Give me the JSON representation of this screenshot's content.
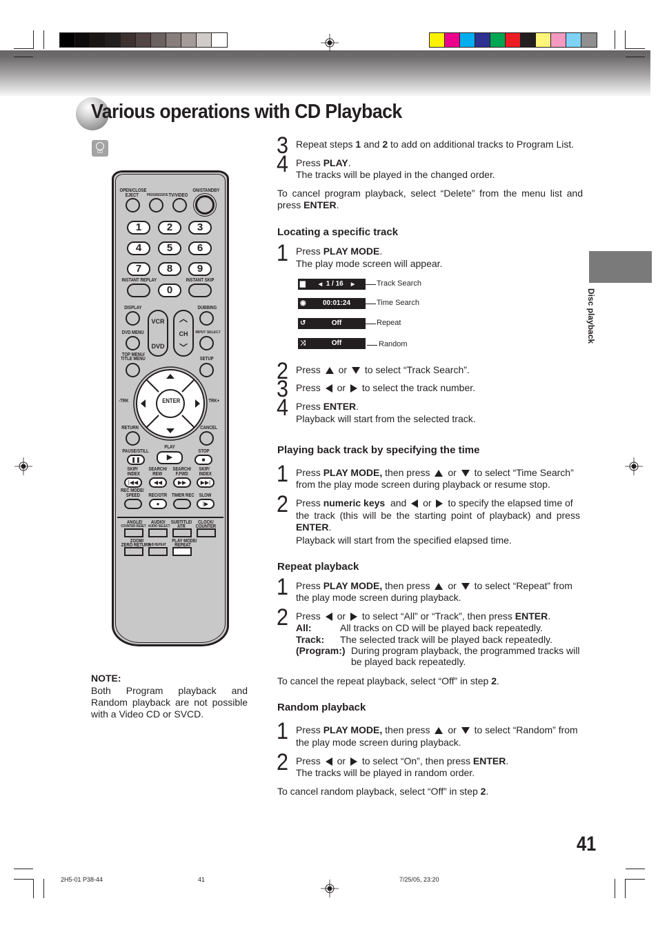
{
  "print_marks": {
    "gray_swatches": [
      "#000000",
      "#0d0b0b",
      "#1a1616",
      "#231f1e",
      "#3b3230",
      "#514644",
      "#6b615f",
      "#877d7b",
      "#a59b99",
      "#d1cbc9",
      "#ffffff"
    ],
    "color_swatches": [
      "#fff200",
      "#ec008c",
      "#00aeef",
      "#2e3192",
      "#00a651",
      "#ed1c24",
      "#231f20",
      "#fff57a",
      "#f49ac1",
      "#7fd2f5",
      "#8f8f8f"
    ]
  },
  "page_title": "Various operations with CD Playback",
  "cd_badge": {
    "icon": "cd-disc-icon",
    "label": "CD"
  },
  "remote": {
    "top_labels": {
      "open_close": "OPEN/CLOSE",
      "eject": "EJECT",
      "progressive": "PROGRESSIVE",
      "tv_video": "TV/VIDEO",
      "on_standby": "ON/STANDBY"
    },
    "numbers": [
      "1",
      "2",
      "3",
      "4",
      "5",
      "6",
      "7",
      "8",
      "9",
      "0"
    ],
    "instant_replay": "INSTANT REPLAY",
    "instant_skip": "INSTANT SKIP",
    "display": "DISPLAY",
    "dubbing": "DUBBING",
    "vcr": "VCR",
    "dvd": "DVD",
    "ch": "CH",
    "dvd_menu": "DVD MENU",
    "input_select": "INPUT SELECT",
    "top_menu": "TOP MENU/",
    "title_menu": "TITLE MENU",
    "setup": "SETUP",
    "trk_minus": "-TRK",
    "trk_plus": "TRK+",
    "enter": "ENTER",
    "return": "RETURN",
    "cancel": "CANCEL",
    "pause_still": "PAUSE/STILL",
    "play": "PLAY",
    "stop": "STOP",
    "skip_index_l": [
      "SKIP/",
      "INDEX"
    ],
    "search_rew": [
      "SEARCH/",
      "REW"
    ],
    "search_ffwd": [
      "SEARCH/",
      "F.FWD"
    ],
    "skip_index_r": [
      "SKIP/",
      "INDEX"
    ],
    "rec_mode": [
      "REC MODE/",
      "SPEED"
    ],
    "rec_otr": "REC/OTR",
    "timer_rec": "TIMER REC",
    "slow": "SLOW",
    "angle": [
      "ANGLE/",
      "COUNTER RESET"
    ],
    "audio": [
      "AUDIO/",
      "AUDIO SELECT"
    ],
    "subtitle": [
      "SUBTITLE/",
      "ATR"
    ],
    "clock": [
      "CLOCK/",
      "COUNTER"
    ],
    "zoom": [
      "ZOOM/",
      "ZERO RETURN"
    ],
    "ab_repeat": "A-B REPEAT",
    "play_mode": [
      "PLAY MODE/",
      "REPEAT"
    ]
  },
  "note": {
    "heading": "NOTE:",
    "body": "Both Program playback and Random playback are not possible with a Video CD or SVCD."
  },
  "program_steps": [
    {
      "num": "3",
      "pre": "Repeat steps ",
      "b1": "1",
      "mid": " and ",
      "b2": "2",
      "post": " to add on additional tracks to Program List."
    },
    {
      "num": "4",
      "pre": "Press ",
      "bold": "PLAY",
      "post": ".",
      "line2": "The tracks will be played in the changed order."
    }
  ],
  "program_cancel": {
    "pre": "To cancel program playback, select “Delete” from the menu list and press ",
    "bold": "ENTER",
    "post": "."
  },
  "sections": {
    "locate": {
      "heading": "Locating a specific track",
      "s1": {
        "num": "1",
        "pre": "Press ",
        "bold": "PLAY MODE",
        "post": ".",
        "line2": "The play mode screen will appear."
      },
      "osd": [
        {
          "icon": "folder-icon",
          "value": "1 / 16",
          "label": "Track Search"
        },
        {
          "icon": "clock-icon",
          "value": "00:01:24",
          "label": "Time Search"
        },
        {
          "icon": "repeat-icon",
          "value": "Off",
          "label": "Repeat"
        },
        {
          "icon": "random-icon",
          "value": "Off",
          "label": "Random"
        }
      ],
      "s2": {
        "num": "2",
        "pre": "Press",
        "or": "or",
        "post": "to select “Track Search”."
      },
      "s3": {
        "num": "3",
        "pre": "Press",
        "or": "or",
        "post": "to select the track number."
      },
      "s4": {
        "num": "4",
        "pre": "Press ",
        "bold": "ENTER",
        "post": ".",
        "line2": "Playback will start from the selected track."
      }
    },
    "time": {
      "heading": "Playing back track by specifying the time",
      "s1": {
        "num": "1",
        "pre": "Press ",
        "bold": "PLAY MODE,",
        "mid": " then press",
        "or": "or",
        "post": "to select “Time Search”",
        "line2": "from the play mode screen during playback or resume stop."
      },
      "s2": {
        "num": "2",
        "pre": "Press ",
        "bold": "numeric keys",
        "mid": " and",
        "or": "or",
        "post": "to specify the elapsed time of",
        "line2": "the track (this will be the starting point of playback) and press",
        "line3": "ENTER",
        "line3_post": ".",
        "line4": "Playback will start from the specified elapsed time."
      }
    },
    "repeat": {
      "heading": "Repeat playback",
      "s1": {
        "num": "1",
        "pre": "Press ",
        "bold": "PLAY MODE,",
        "mid": " then press",
        "or": "or",
        "post": "to select “Repeat” from",
        "line2": "the play mode screen during playback."
      },
      "s2": {
        "num": "2",
        "pre": "Press",
        "or": "or",
        "post": "to select “All” or “Track”, then press ",
        "bold": "ENTER",
        "post2": "."
      },
      "defs": [
        {
          "term": "All:",
          "desc": "All tracks on CD will be played back repeatedly."
        },
        {
          "term": "Track:",
          "desc": "The selected track will be played back repeatedly."
        },
        {
          "term": "(Program:)",
          "desc": "During program playback, the programmed tracks will",
          "desc2": "be played back repeatedly."
        }
      ],
      "cancel": {
        "pre": "To cancel the repeat playback, select “Off” in step ",
        "bold": "2",
        "post": "."
      }
    },
    "random": {
      "heading": "Random playback",
      "s1": {
        "num": "1",
        "pre": "Press ",
        "bold": "PLAY MODE,",
        "mid": " then press",
        "or": "or",
        "post": "to select “Random” from",
        "line2": "the play mode screen during playback."
      },
      "s2": {
        "num": "2",
        "pre": "Press",
        "or": "or",
        "post": "to select “On”, then press ",
        "bold": "ENTER",
        "post2": ".",
        "line2": "The tracks will be played in random order."
      },
      "cancel": {
        "pre": "To cancel random playback, select “Off” in step ",
        "bold": "2",
        "post": "."
      }
    }
  },
  "side_tab": {
    "label": "Disc playback"
  },
  "page_number": "41",
  "footer": {
    "left": "2H5-01 P38-44",
    "center": "41",
    "right": "7/25/05, 23:20"
  }
}
